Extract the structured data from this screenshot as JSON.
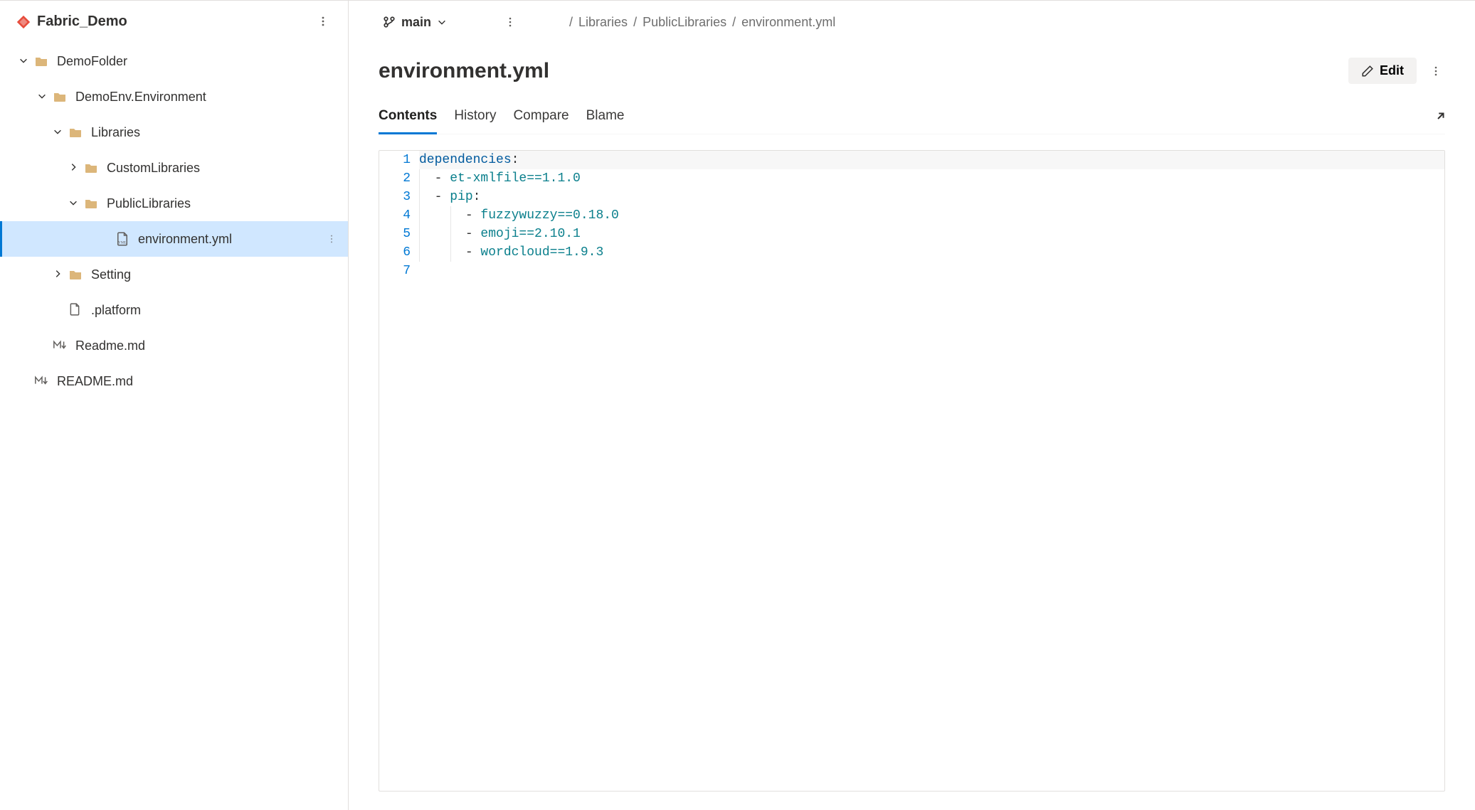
{
  "repo": {
    "name": "Fabric_Demo"
  },
  "tree": {
    "items": [
      {
        "label": "DemoFolder",
        "indent": 0,
        "chevron": "down",
        "icon": "folder"
      },
      {
        "label": "DemoEnv.Environment",
        "indent": 1,
        "chevron": "down",
        "icon": "folder"
      },
      {
        "label": "Libraries",
        "indent": 2,
        "chevron": "down",
        "icon": "folder"
      },
      {
        "label": "CustomLibraries",
        "indent": 3,
        "chevron": "right",
        "icon": "folder"
      },
      {
        "label": "PublicLibraries",
        "indent": 3,
        "chevron": "down",
        "icon": "folder"
      },
      {
        "label": "environment.yml",
        "indent": 4,
        "chevron": "none",
        "icon": "yml",
        "selected": true,
        "more": true
      },
      {
        "label": "Setting",
        "indent": 2,
        "chevron": "right",
        "icon": "folder"
      },
      {
        "label": ".platform",
        "indent": 2,
        "chevron": "none",
        "icon": "file"
      },
      {
        "label": "Readme.md",
        "indent": 1,
        "chevron": "none",
        "icon": "md"
      },
      {
        "label": "README.md",
        "indent": 0,
        "chevron": "none",
        "icon": "md"
      }
    ]
  },
  "branch": {
    "name": "main"
  },
  "breadcrumb": [
    "Libraries",
    "PublicLibraries",
    "environment.yml"
  ],
  "file": {
    "title": "environment.yml"
  },
  "actions": {
    "edit_label": "Edit"
  },
  "tabs": [
    "Contents",
    "History",
    "Compare",
    "Blame"
  ],
  "active_tab": 0,
  "code": {
    "lines": [
      {
        "n": 1,
        "text": "dependencies:",
        "tokens": [
          [
            "dependencies",
            "key"
          ],
          [
            ":",
            "p"
          ]
        ]
      },
      {
        "n": 2,
        "text": "  - et-xmlfile==1.1.0",
        "tokens": [
          [
            "  ",
            "p"
          ],
          [
            "- ",
            "p"
          ],
          [
            "et-xmlfile==1.1.0",
            "str"
          ]
        ],
        "guide": 1
      },
      {
        "n": 3,
        "text": "  - pip:",
        "tokens": [
          [
            "  ",
            "p"
          ],
          [
            "- ",
            "p"
          ],
          [
            "pip",
            "str"
          ],
          [
            ":",
            "p"
          ]
        ],
        "guide": 1
      },
      {
        "n": 4,
        "text": "      - fuzzywuzzy==0.18.0",
        "tokens": [
          [
            "      ",
            "p"
          ],
          [
            "- ",
            "p"
          ],
          [
            "fuzzywuzzy==0.18.0",
            "str"
          ]
        ],
        "guide": 2
      },
      {
        "n": 5,
        "text": "      - emoji==2.10.1",
        "tokens": [
          [
            "      ",
            "p"
          ],
          [
            "- ",
            "p"
          ],
          [
            "emoji==2.10.1",
            "str"
          ]
        ],
        "guide": 2
      },
      {
        "n": 6,
        "text": "      - wordcloud==1.9.3",
        "tokens": [
          [
            "      ",
            "p"
          ],
          [
            "- ",
            "p"
          ],
          [
            "wordcloud==1.9.3",
            "str"
          ]
        ],
        "guide": 2
      },
      {
        "n": 7,
        "text": "",
        "tokens": []
      }
    ]
  }
}
